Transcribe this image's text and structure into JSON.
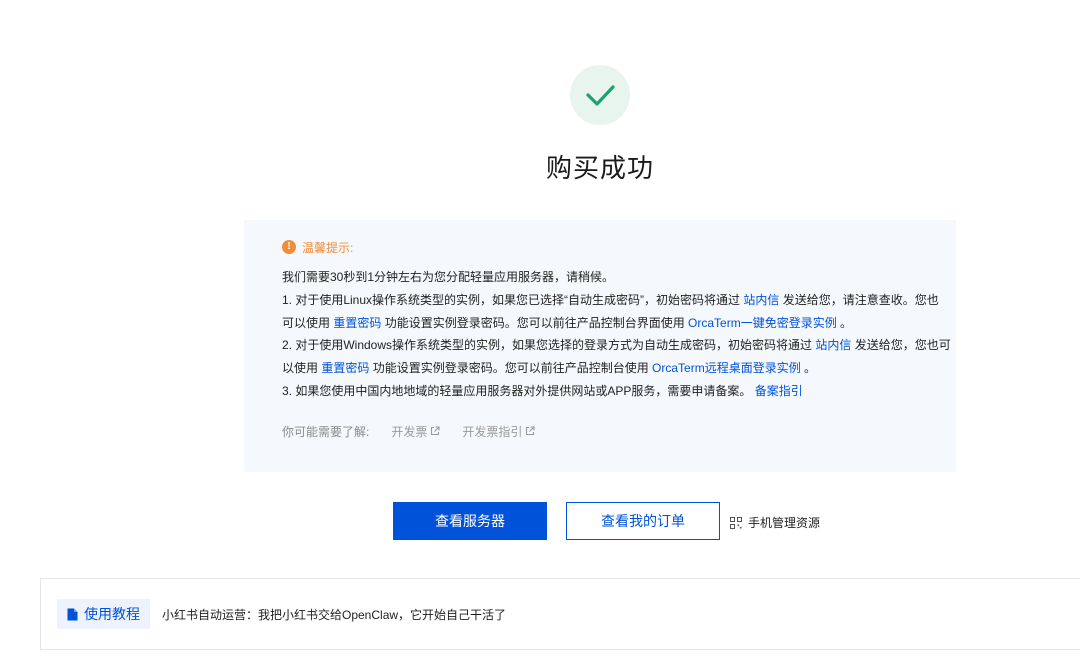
{
  "title": "购买成功",
  "notice": {
    "heading": "温馨提示:",
    "line1": "我们需要30秒到1分钟左右为您分配轻量应用服务器，请稍候。",
    "l2_a": "1. 对于使用Linux操作系统类型的实例，如果您已选择“自动生成密码”，初始密码将通过 ",
    "l2_link": "站内信",
    "l2_b": " 发送给您，请注意查收。您也",
    "l3_a": "可以使用 ",
    "l3_link1": "重置密码",
    "l3_b": " 功能设置实例登录密码。您可以前往产品控制台界面使用 ",
    "l3_link2": "OrcaTerm一键免密登录实例",
    "l3_c": " 。",
    "l4_a": "2. 对于使用Windows操作系统类型的实例，如果您选择的登录方式为自动生成密码，初始密码将通过 ",
    "l4_link": "站内信",
    "l4_b": " 发送给您，您也可",
    "l5_a": "以使用 ",
    "l5_link1": "重置密码",
    "l5_b": " 功能设置实例登录密码。您可以前往产品控制台使用 ",
    "l5_link2": "OrcaTerm远程桌面登录实例",
    "l5_c": " 。",
    "l6_a": "3. 如果您使用中国内地地域的轻量应用服务器对外提供网站或APP服务，需要申请备案。 ",
    "l6_link": "备案指引",
    "maybe_label": "你可能需要了解:",
    "maybe_items": [
      "开发票",
      "开发票指引"
    ]
  },
  "buttons": {
    "view_servers": "查看服务器",
    "view_orders": "查看我的订单",
    "mobile_manage": "手机管理资源"
  },
  "tutorial": {
    "tag": "使用教程",
    "text": "小红书自动运营：我把小红书交给OpenClaw，它开始自己干活了"
  },
  "colors": {
    "primary": "#0052d9",
    "success": "#1aa36c",
    "warning": "#f08c3c"
  },
  "icons": [
    "check-icon",
    "warning-icon",
    "external-link-icon",
    "qr-code-icon",
    "document-icon"
  ]
}
